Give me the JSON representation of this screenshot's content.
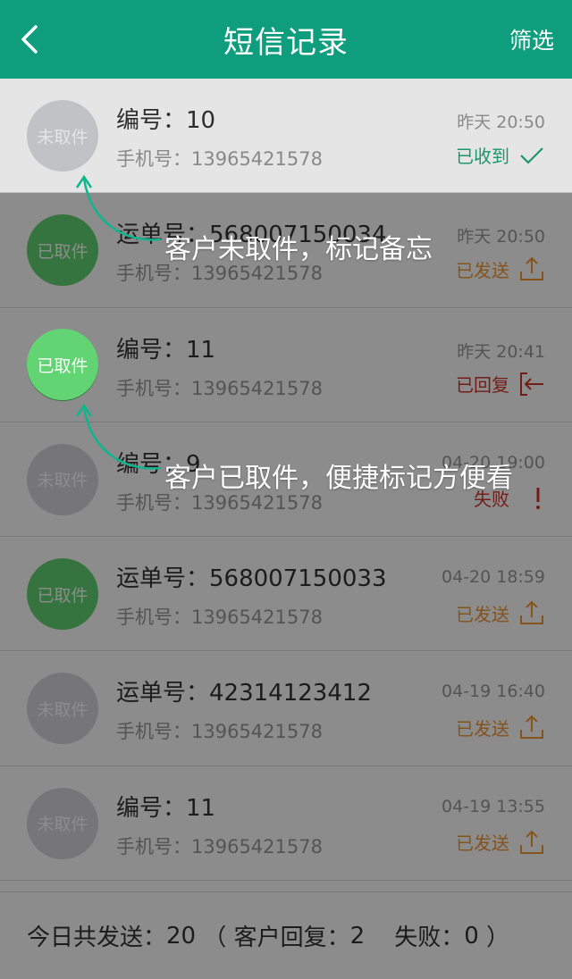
{
  "header": {
    "title": "短信记录",
    "filter_label": "筛选"
  },
  "rows": [
    {
      "avatar_label": "未取件",
      "avatar_style": "gray",
      "main_label": "编号：",
      "main_value": "10",
      "phone_label": "手机号：",
      "phone": "13965421578",
      "time": "昨天 20:50",
      "status": "已收到",
      "status_type": "received"
    },
    {
      "avatar_label": "已取件",
      "avatar_style": "green",
      "main_label": "运单号：",
      "main_value": "568007150034",
      "phone_label": "手机号：",
      "phone": "13965421578",
      "time": "昨天 20:50",
      "status": "已发送",
      "status_type": "sent"
    },
    {
      "avatar_label": "已取件",
      "avatar_style": "green",
      "main_label": "编号：",
      "main_value": "11",
      "phone_label": "手机号：",
      "phone": "13965421578",
      "time": "昨天 20:41",
      "status": "已回复",
      "status_type": "replied"
    },
    {
      "avatar_label": "未取件",
      "avatar_style": "gray",
      "main_label": "编号：",
      "main_value": "9",
      "phone_label": "手机号：",
      "phone": "13965421578",
      "time": "04-20 19:00",
      "status": "失败",
      "status_type": "failed"
    },
    {
      "avatar_label": "已取件",
      "avatar_style": "green",
      "main_label": "运单号：",
      "main_value": "568007150033",
      "phone_label": "手机号：",
      "phone": "13965421578",
      "time": "04-20 18:59",
      "status": "已发送",
      "status_type": "sent"
    },
    {
      "avatar_label": "未取件",
      "avatar_style": "gray",
      "main_label": "运单号：",
      "main_value": "42314123412",
      "phone_label": "手机号：",
      "phone": "13965421578",
      "time": "04-19 16:40",
      "status": "已发送",
      "status_type": "sent"
    },
    {
      "avatar_label": "未取件",
      "avatar_style": "gray",
      "main_label": "编号：",
      "main_value": "11",
      "phone_label": "手机号：",
      "phone": "13965421578",
      "time": "04-19 13:55",
      "status": "已发送",
      "status_type": "sent"
    }
  ],
  "footer": {
    "sent_label": "今日共发送：",
    "sent_count": "20",
    "open_paren": " （ ",
    "reply_label": "客户回复：",
    "reply_count": "2",
    "fail_label": "    失败：",
    "fail_count": "0",
    "close_paren": " ）"
  },
  "hints": {
    "not_picked": "客户未取件，标记备忘",
    "picked": "客户已取件，便捷标记方便看"
  },
  "colors": {
    "header": "#0f9e7d",
    "pending_avatar": "#d7d8dc",
    "picked_avatar": "#63d473",
    "status_received": "#20a77b",
    "status_sent": "#f29733",
    "status_failed": "#d2352a"
  }
}
